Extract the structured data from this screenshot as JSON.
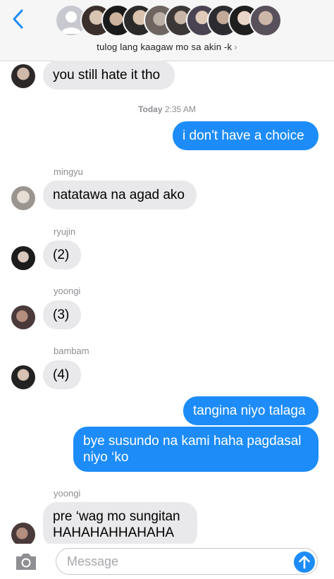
{
  "header": {
    "group_name": "tulog lang kaagaw mo sa akin -k",
    "chevron": "›",
    "back_icon": "chevron-left-icon"
  },
  "timestamp": {
    "day": "Today",
    "time": "2:35 AM"
  },
  "messages": [
    {
      "text": "you still hate it tho",
      "from": "in"
    },
    {
      "text": "i don't have a choice",
      "from": "out"
    },
    {
      "sender": "mingyu",
      "text": "natatawa na agad ako",
      "from": "in"
    },
    {
      "sender": "ryujin",
      "text": "(2)",
      "from": "in"
    },
    {
      "sender": "yoongi",
      "text": "(3)",
      "from": "in"
    },
    {
      "sender": "bambam",
      "text": "(4)",
      "from": "in"
    },
    {
      "text": "tangina niyo talaga",
      "from": "out"
    },
    {
      "text": "bye susundo na kami haha pagdasal niyo ‘ko",
      "from": "out"
    },
    {
      "sender": "yoongi",
      "text": "pre ‘wag mo sungitan HAHAHAHHAHAHA",
      "from": "in"
    }
  ],
  "input": {
    "placeholder": "Message"
  },
  "colors": {
    "outgoing": "#1d8cf8",
    "incoming": "#e9e9eb",
    "header_bg": "#f6f6f7"
  }
}
